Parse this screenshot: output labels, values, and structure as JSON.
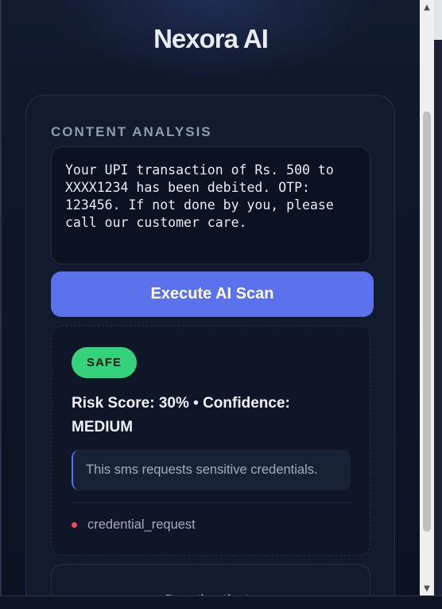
{
  "app": {
    "title": "Nexora AI"
  },
  "analysis": {
    "section_label": "CONTENT ANALYSIS",
    "input_text": "Your UPI transaction of Rs. 500 to XXXX1234 has been debited. OTP: 123456. If not done by you, please call our customer care.",
    "scan_button_label": "Execute AI Scan"
  },
  "result": {
    "badge": "SAFE",
    "risk_line": "Risk Score: 30% • Confidence: MEDIUM",
    "reason": "This sms requests sensitive credentials.",
    "flags": [
      "credential_request"
    ]
  },
  "footer": {
    "deauth_label": "Deauthenticate"
  },
  "colors": {
    "background": "#0b1120",
    "accent": "#5b72ec",
    "safe_badge": "#34d27a",
    "flag_dot": "#ef4b5b"
  },
  "icons": {
    "scroll_up": "scroll-up-arrow-icon",
    "scroll_down": "scroll-down-arrow-icon"
  }
}
